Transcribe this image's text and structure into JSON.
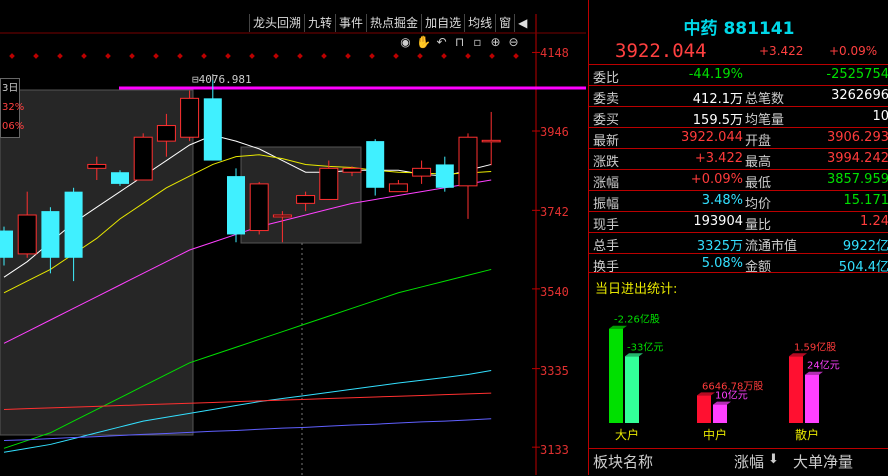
{
  "toolbar": {
    "items": [
      "龙头回溯",
      "九转",
      "事件",
      "热点掘金",
      "加自选",
      "均线",
      "窗"
    ],
    "arrow": "◀"
  },
  "chart_icons": [
    "eye-icon",
    "hand-icon",
    "undo-icon",
    "lock-icon",
    "minimize-icon",
    "zoom-in-icon",
    "zoom-out-icon"
  ],
  "chart": {
    "y_labels": [
      "4148",
      "3946",
      "3742",
      "3540",
      "3335",
      "3133"
    ],
    "high_label": "4076.981",
    "left_box": [
      "3日",
      "32%",
      "06%"
    ],
    "colors": {
      "up": "#ff3030",
      "down": "#40f0ff",
      "magenta": "#ff00ff"
    }
  },
  "chart_data": {
    "type": "candlestick",
    "ylim": [
      3100,
      4180
    ],
    "high_marker": 4076.981,
    "candles": [
      {
        "o": 3690,
        "c": 3620,
        "h": 3700,
        "l": 3600
      },
      {
        "o": 3630,
        "c": 3730,
        "h": 3790,
        "l": 3620
      },
      {
        "o": 3740,
        "c": 3620,
        "h": 3750,
        "l": 3580
      },
      {
        "o": 3790,
        "c": 3620,
        "h": 3800,
        "l": 3560
      },
      {
        "o": 3850,
        "c": 3860,
        "h": 3880,
        "l": 3820
      },
      {
        "o": 3840,
        "c": 3810,
        "h": 3845,
        "l": 3805
      },
      {
        "o": 3820,
        "c": 3930,
        "h": 3940,
        "l": 3820
      },
      {
        "o": 3920,
        "c": 3960,
        "h": 3990,
        "l": 3880
      },
      {
        "o": 3930,
        "c": 4030,
        "h": 4050,
        "l": 3920
      },
      {
        "o": 4030,
        "c": 3870,
        "h": 4077,
        "l": 3870
      },
      {
        "o": 3830,
        "c": 3680,
        "h": 3850,
        "l": 3660
      },
      {
        "o": 3690,
        "c": 3810,
        "h": 3815,
        "l": 3680
      },
      {
        "o": 3725,
        "c": 3730,
        "h": 3740,
        "l": 3660
      },
      {
        "o": 3760,
        "c": 3780,
        "h": 3790,
        "l": 3740
      },
      {
        "o": 3770,
        "c": 3850,
        "h": 3870,
        "l": 3770
      },
      {
        "o": 3840,
        "c": 3850,
        "h": 3855,
        "l": 3830
      },
      {
        "o": 3920,
        "c": 3800,
        "h": 3925,
        "l": 3780
      },
      {
        "o": 3790,
        "c": 3810,
        "h": 3820,
        "l": 3790
      },
      {
        "o": 3830,
        "c": 3850,
        "h": 3870,
        "l": 3810
      },
      {
        "o": 3860,
        "c": 3800,
        "h": 3880,
        "l": 3790
      },
      {
        "o": 3805,
        "c": 3930,
        "h": 3940,
        "l": 3720
      },
      {
        "o": 3922,
        "c": 3922,
        "h": 3995,
        "l": 3858
      }
    ],
    "ma_lines": [
      {
        "color": "#ffffff",
        "values": [
          3570,
          3610,
          3660,
          3710,
          3750,
          3790,
          3830,
          3870,
          3910,
          3935,
          3920,
          3900,
          3870,
          3840,
          3840,
          3845,
          3845,
          3845,
          3835,
          3830,
          3845,
          3860
        ]
      },
      {
        "color": "#e8e800",
        "values": [
          3530,
          3560,
          3590,
          3630,
          3670,
          3720,
          3760,
          3800,
          3830,
          3860,
          3880,
          3885,
          3875,
          3860,
          3855,
          3852,
          3845,
          3840,
          3838,
          3835,
          3838,
          3842
        ]
      },
      {
        "color": "#ff40ff",
        "values": [
          3400,
          3430,
          3460,
          3490,
          3520,
          3550,
          3580,
          3610,
          3640,
          3660,
          3680,
          3700,
          3715,
          3730,
          3745,
          3760,
          3770,
          3780,
          3790,
          3800,
          3810,
          3820
        ]
      },
      {
        "color": "#00e000",
        "values": [
          3130,
          3150,
          3170,
          3200,
          3230,
          3260,
          3290,
          3320,
          3350,
          3370,
          3390,
          3410,
          3430,
          3450,
          3470,
          3490,
          3510,
          3530,
          3545,
          3560,
          3575,
          3590
        ]
      },
      {
        "color": "#33e0ff",
        "values": [
          3120,
          3130,
          3140,
          3155,
          3170,
          3185,
          3200,
          3210,
          3220,
          3230,
          3240,
          3250,
          3258,
          3266,
          3274,
          3282,
          3290,
          3298,
          3305,
          3312,
          3320,
          3330
        ]
      },
      {
        "color": "#ff3030",
        "values": [
          3230,
          3232,
          3234,
          3236,
          3238,
          3240,
          3242,
          3244,
          3246,
          3248,
          3250,
          3252,
          3254,
          3256,
          3258,
          3260,
          3262,
          3264,
          3266,
          3268,
          3270,
          3272
        ]
      },
      {
        "color": "#6060ff",
        "values": [
          3150,
          3152,
          3155,
          3158,
          3160,
          3163,
          3166,
          3168,
          3171,
          3174,
          3176,
          3179,
          3182,
          3184,
          3187,
          3190,
          3192,
          3195,
          3198,
          3200,
          3203,
          3206
        ]
      }
    ]
  },
  "panel": {
    "title": "中药 881141",
    "price": "3922.044",
    "change": "+3.422",
    "pct": "+0.09%",
    "rows": [
      {
        "l1": "委比",
        "v1": "-44.19%",
        "c1": "green",
        "l2": "",
        "v2": "-2525754",
        "c2": "green"
      },
      {
        "l1": "委卖",
        "v1": "412.1万",
        "c1": "white",
        "l2": "总笔数",
        "v2": "3262696",
        "c2": "white"
      },
      {
        "l1": "委买",
        "v1": "159.5万",
        "c1": "white",
        "l2": "均笔量",
        "v2": "10",
        "c2": "white"
      },
      {
        "l1": "最新",
        "v1": "3922.044",
        "c1": "red",
        "l2": "开盘",
        "v2": "3906.293",
        "c2": "red"
      },
      {
        "l1": "涨跌",
        "v1": "+3.422",
        "c1": "red",
        "l2": "最高",
        "v2": "3994.242",
        "c2": "red"
      },
      {
        "l1": "涨幅",
        "v1": "+0.09%",
        "c1": "red",
        "l2": "最低",
        "v2": "3857.959",
        "c2": "green"
      },
      {
        "l1": "振幅",
        "v1": "3.48%",
        "c1": "cyan",
        "l2": "均价",
        "v2": "15.171",
        "c2": "green"
      },
      {
        "l1": "现手",
        "v1": "193904",
        "c1": "white",
        "l2": "量比",
        "v2": "1.24",
        "c2": "red"
      },
      {
        "l1": "总手",
        "v1": "3325万",
        "c1": "cyan",
        "l2": "流通市值",
        "v2": "9922亿",
        "c2": "cyan"
      },
      {
        "l1": "换手",
        "v1": "5.08%",
        "c1": "cyan",
        "l2": "金额",
        "v2": "504.4亿",
        "c2": "cyan"
      }
    ],
    "flow": {
      "title": "当日进出统计:",
      "groups": [
        {
          "label": "大户",
          "in_label": "-2.26亿股",
          "out_label": "-33亿元",
          "in_color": "#00e000",
          "out_color": "#33ff99",
          "in_val": 0.82,
          "out_val": 0.58,
          "lbl_color": "#00e000"
        },
        {
          "label": "中户",
          "in_label": "6646.78万股",
          "out_label": "10亿元",
          "in_color": "#ff1030",
          "out_color": "#ff40ff",
          "in_val": 0.24,
          "out_val": 0.16,
          "lbl_color": "#ff3b3b"
        },
        {
          "label": "散户",
          "in_label": "1.59亿股",
          "out_label": "24亿元",
          "in_color": "#ff1030",
          "out_color": "#ff40ff",
          "in_val": 0.58,
          "out_val": 0.42,
          "lbl_color": "#ff3b3b"
        }
      ]
    },
    "bottom": {
      "col1": "板块名称",
      "col2": "涨幅",
      "col2_arrow": "⬇",
      "col3": "大单净量"
    }
  }
}
